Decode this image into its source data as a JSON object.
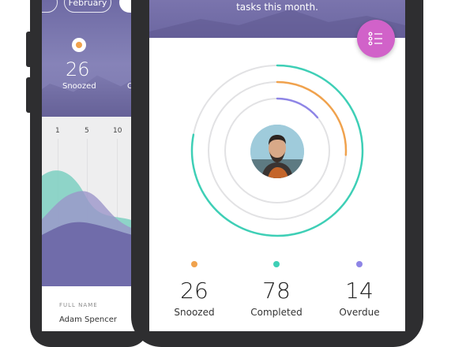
{
  "back_phone": {
    "pills": [
      "",
      "February",
      ""
    ],
    "stat_value": "26",
    "stat_label": "Snoozed",
    "stat_label_cut": "C",
    "ticks": [
      "1",
      "5",
      "10"
    ],
    "full_name_label": "FULL NAME",
    "full_name_value": "Adam Spencer"
  },
  "front_phone": {
    "header_text": "tasks this month.",
    "menu_icon": "list-icon",
    "progress": {
      "completed": 0.78,
      "snoozed": 0.26,
      "overdue": 0.14
    },
    "stats": [
      {
        "value": "26",
        "label": "Snoozed",
        "color": "#f0a24d"
      },
      {
        "value": "78",
        "label": "Completed",
        "color": "#3ecfb6"
      },
      {
        "value": "14",
        "label": "Overdue",
        "color": "#8e85e6"
      }
    ]
  }
}
